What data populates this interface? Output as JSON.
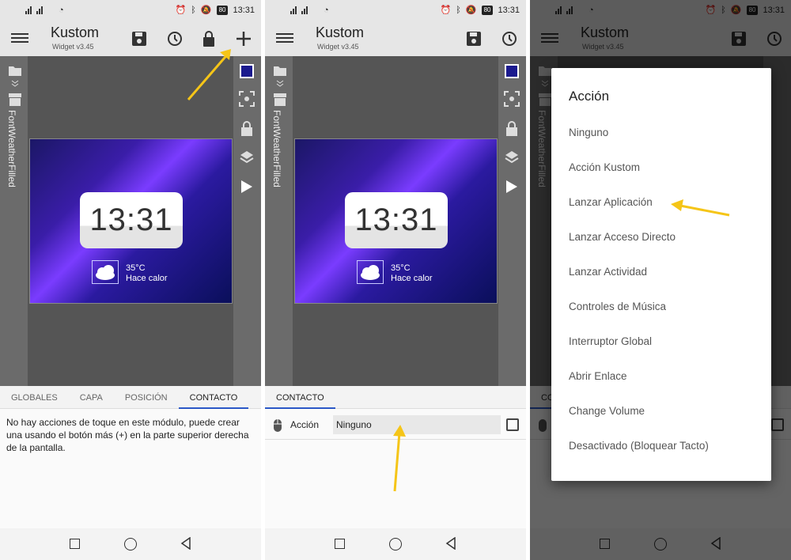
{
  "status": {
    "time": "13:31",
    "battery": "80"
  },
  "app": {
    "title": "Kustom",
    "subtitle": "Widget v3.45"
  },
  "module": {
    "name": "FontWeatherFilled"
  },
  "preview": {
    "clock": "13:31",
    "temp": "35°C",
    "condition": "Hace calor"
  },
  "screen1": {
    "tabs": [
      "GLOBALES",
      "CAPA",
      "POSICIÓN",
      "CONTACTO"
    ],
    "message": "No hay acciones de toque en este módulo, puede crear una usando el botón más (+) en la parte superior derecha de la pantalla."
  },
  "screen2": {
    "tab": "CONTACTO",
    "action_label": "Acción",
    "action_value": "Ninguno"
  },
  "screen3": {
    "tab_partial": "CO",
    "dialog_title": "Acción",
    "options": [
      "Ninguno",
      "Acción Kustom",
      "Lanzar Aplicación",
      "Lanzar Acceso Directo",
      "Lanzar Actividad",
      "Controles de Música",
      "Interruptor Global",
      "Abrir Enlace",
      "Change Volume",
      "Desactivado (Bloquear Tacto)"
    ]
  },
  "colors": {
    "arrow": "#f5c518",
    "accent": "#2b57c7"
  }
}
